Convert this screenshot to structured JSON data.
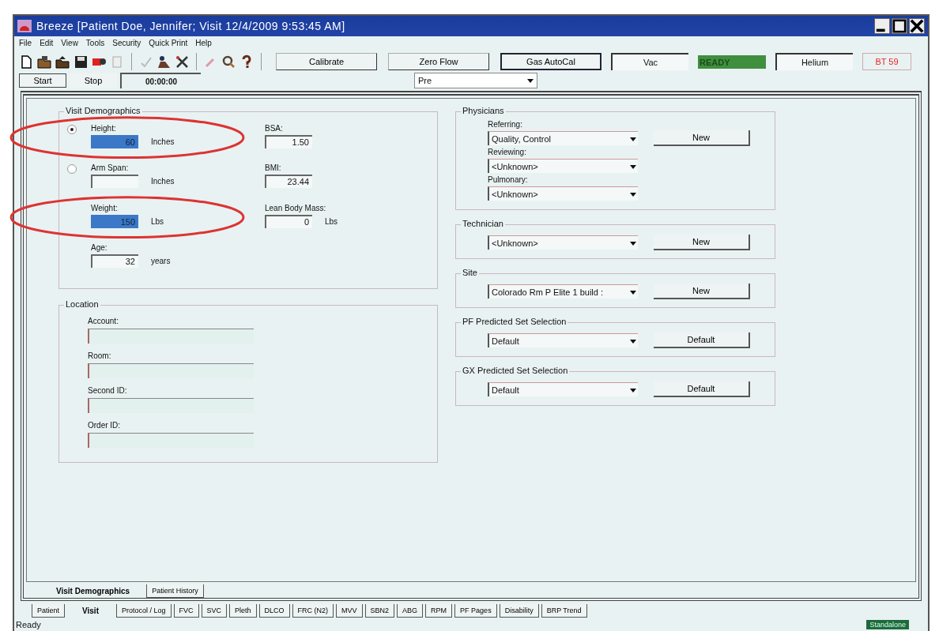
{
  "window": {
    "title": "Breeze   [Patient   Doe, Jennifer;   Visit   12/4/2009 9:53:45 AM]"
  },
  "menu": [
    "File",
    "Edit",
    "View",
    "Tools",
    "Security",
    "Quick Print",
    "Help"
  ],
  "toolbar": {
    "buttons": [
      {
        "label": "Calibrate",
        "focused": false
      },
      {
        "label": "Zero Flow",
        "focused": false
      },
      {
        "label": "Gas AutoCal",
        "focused": true
      }
    ],
    "indicators": [
      {
        "kind": "field",
        "text": "Vac"
      },
      {
        "kind": "status",
        "text": "READY"
      },
      {
        "kind": "field",
        "text": "Helium"
      },
      {
        "kind": "alert",
        "text": "BT 59"
      }
    ]
  },
  "run": {
    "start": "Start",
    "stop": "Stop",
    "timer": "00:00:00",
    "phase": "Pre"
  },
  "demographics": {
    "title": "Visit Demographics",
    "measures": [
      {
        "label": "Height:",
        "selected": true,
        "value": "60",
        "unit": "Inches",
        "highlighted": true,
        "circled": true
      },
      {
        "label": "Arm Span:",
        "selected": false,
        "unit": "Inches",
        "highlighted": false
      }
    ],
    "weight": {
      "label": "Weight:",
      "value": "150",
      "unit": "Lbs",
      "highlighted": true,
      "circled": true
    },
    "age": {
      "label": "Age:",
      "value": "32",
      "unit": "years",
      "highlighted": false
    },
    "results": [
      {
        "label": "BSA:",
        "value": "1.50"
      },
      {
        "label": "BMI:",
        "value": "23.44"
      },
      {
        "label": "Lean Body Mass:",
        "value": "0",
        "unit": "Lbs"
      }
    ]
  },
  "location": {
    "title": "Location",
    "fields": [
      "Account:",
      "Room:",
      "Second ID:",
      "Order ID:"
    ]
  },
  "groups": [
    {
      "title": "Physicians",
      "rows": [
        {
          "label": "Referring:",
          "value": "Quality, Control",
          "button": "New"
        },
        {
          "label": "Reviewing:",
          "value": "<Unknown>"
        },
        {
          "label": "Pulmonary:",
          "value": "<Unknown>"
        }
      ]
    },
    {
      "title": "Technician",
      "rows": [
        {
          "value": "<Unknown>",
          "button": "New"
        }
      ]
    },
    {
      "title": "Site",
      "rows": [
        {
          "value": "Colorado Rm P Elite 1 build :",
          "button": "New"
        }
      ]
    },
    {
      "title": "PF Predicted Set Selection",
      "rows": [
        {
          "value": "Default",
          "button": "Default"
        }
      ]
    },
    {
      "title": "GX Predicted Set Selection",
      "rows": [
        {
          "value": "Default",
          "button": "Default"
        }
      ]
    }
  ],
  "inner_tabs": [
    {
      "label": "Visit Demographics",
      "selected": true
    },
    {
      "label": "Patient History",
      "selected": false
    }
  ],
  "outer_tabs": [
    {
      "label": "Patient",
      "selected": false
    },
    {
      "label": "Visit",
      "selected": true
    },
    {
      "label": "Protocol / Log",
      "selected": false
    },
    {
      "label": "FVC",
      "selected": false
    },
    {
      "label": "SVC",
      "selected": false
    },
    {
      "label": "Pleth",
      "selected": false
    },
    {
      "label": "DLCO",
      "selected": false
    },
    {
      "label": "FRC (N2)",
      "selected": false
    },
    {
      "label": "MVV",
      "selected": false
    },
    {
      "label": "SBN2",
      "selected": false
    },
    {
      "label": "ABG",
      "selected": false
    },
    {
      "label": "RPM",
      "selected": false
    },
    {
      "label": "PF Pages",
      "selected": false
    },
    {
      "label": "Disability",
      "selected": false
    },
    {
      "label": "BRP Trend",
      "selected": false
    }
  ],
  "status_bar": {
    "text": "Ready",
    "mode": "Standalone"
  }
}
